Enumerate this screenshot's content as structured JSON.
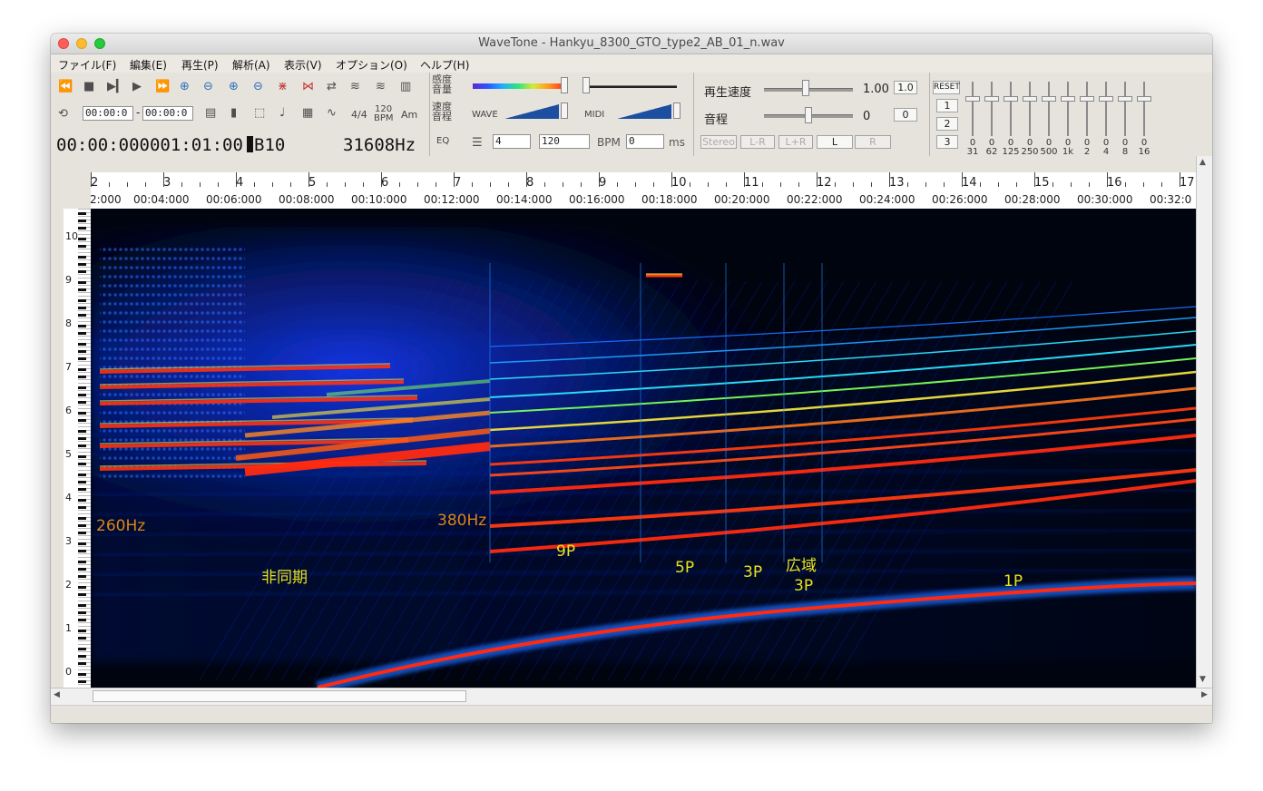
{
  "window": {
    "title": "WaveTone - Hankyu_8300_GTO_type2_AB_01_n.wav"
  },
  "menu": [
    "ファイル(F)",
    "編集(E)",
    "再生(P)",
    "解析(A)",
    "表示(V)",
    "オプション(O)",
    "ヘルプ(H)"
  ],
  "toolbar": {
    "time_start": "00:00:0",
    "time_end": "00:00:0",
    "meter": "4/4",
    "bpm_top": "120",
    "bpm_bottom": "BPM",
    "chord": "Am",
    "position": "00:00:000001:01:00",
    "note": "B10",
    "frequency": "31608Hz",
    "eq_label": "EQ",
    "sens_label_1": "感度",
    "sens_label_2": "音量",
    "speed_label_1": "速度",
    "speed_label_2": "音程",
    "wave_label": "WAVE",
    "midi_label": "MIDI",
    "beats_value": "4",
    "tempo_value": "120",
    "bpm_label": "BPM",
    "ms_value": "0",
    "ms_label": "ms",
    "speed_name": "再生速度",
    "speed_value": "1.00",
    "speed_reset": "1.0",
    "pitch_name": "音程",
    "pitch_value": "0",
    "pitch_reset": "0",
    "channel_buttons": [
      "Stereo",
      "L-R",
      "L+R",
      "L",
      "R"
    ],
    "reset_label": "RESET",
    "preset_buttons": [
      "1",
      "2",
      "3"
    ],
    "eq_bands": [
      "31",
      "62",
      "125",
      "250",
      "500",
      "1k",
      "2",
      "4",
      "8",
      "16"
    ],
    "eq_values": [
      "0",
      "0",
      "0",
      "0",
      "0",
      "0",
      "0",
      "0",
      "0",
      "0"
    ]
  },
  "ruler": {
    "bars": [
      "2",
      "3",
      "4",
      "5",
      "6",
      "7",
      "8",
      "9",
      "10",
      "11",
      "12",
      "13",
      "14",
      "15",
      "16",
      "17"
    ],
    "times": [
      "2:000",
      "00:04:000",
      "00:06:000",
      "00:08:000",
      "00:10:000",
      "00:12:000",
      "00:14:000",
      "00:16:000",
      "00:18:000",
      "00:20:000",
      "00:22:000",
      "00:24:000",
      "00:26:000",
      "00:28:000",
      "00:30:000",
      "00:32:0"
    ]
  },
  "piano": {
    "octaves": [
      "10",
      "9",
      "8",
      "7",
      "6",
      "5",
      "4",
      "3",
      "2",
      "1",
      "0"
    ]
  },
  "annotations": {
    "hz260": "260Hz",
    "hz380": "380Hz",
    "async": "非同期",
    "p9": "9P",
    "p5": "5P",
    "p3": "3P",
    "wide": "広域",
    "wide_p3": "3P",
    "p1": "1P"
  },
  "colors": {
    "annotation_orange": "#d8861a",
    "annotation_yellow": "#e8e21c"
  }
}
